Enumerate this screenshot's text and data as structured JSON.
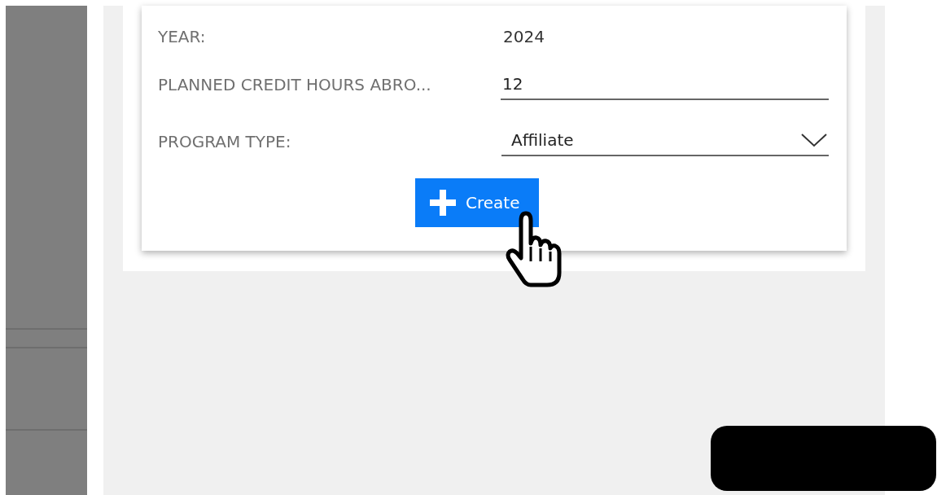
{
  "form": {
    "fields": [
      {
        "kind": "static",
        "label": "YEAR:",
        "value": "2024"
      },
      {
        "kind": "input",
        "label": "PLANNED CREDIT HOURS ABRO...",
        "value": "12"
      },
      {
        "kind": "select",
        "label": "PROGRAM TYPE:",
        "value": "Affiliate"
      }
    ],
    "submit": {
      "label": "Create"
    }
  }
}
